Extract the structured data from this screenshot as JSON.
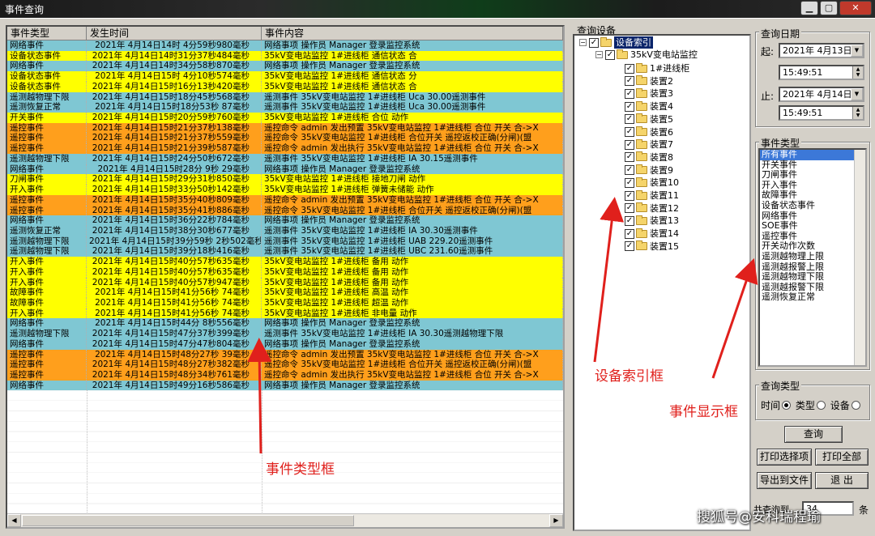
{
  "window": {
    "title": "事件查询",
    "btn_min": "▁",
    "btn_max": "▢",
    "btn_close": "✕"
  },
  "table": {
    "headers": [
      "事件类型",
      "发生时间",
      "事件内容"
    ],
    "rows": [
      {
        "type": "网络事件",
        "time": "2021年 4月14日14时 4分59秒980毫秒",
        "content": "网络事项 操作员 Manager 登录监控系统",
        "color": "blue"
      },
      {
        "type": "设备状态事件",
        "time": "2021年 4月14日14时31分37秒484毫秒",
        "content": "35kV变电站监控 1#进线柜 通信状态 合",
        "color": "yellow"
      },
      {
        "type": "网络事件",
        "time": "2021年 4月14日14时34分58秒870毫秒",
        "content": "网络事项 操作员 Manager 登录监控系统",
        "color": "blue"
      },
      {
        "type": "设备状态事件",
        "time": "2021年 4月14日15时 4分10秒574毫秒",
        "content": "35kV变电站监控 1#进线柜 通信状态 分",
        "color": "yellow"
      },
      {
        "type": "设备状态事件",
        "time": "2021年 4月14日15时16分13秒420毫秒",
        "content": "35kV变电站监控 1#进线柜 通信状态 合",
        "color": "yellow"
      },
      {
        "type": "遥测越物理下限",
        "time": "2021年 4月14日15时18分45秒568毫秒",
        "content": "遥测事件 35kV变电站监控 1#进线柜 Uca 30.00遥测事件",
        "color": "blue"
      },
      {
        "type": "遥测恢复正常",
        "time": "2021年 4月14日15时18分53秒 87毫秒",
        "content": "遥测事件 35kV变电站监控 1#进线柜 Uca 30.00遥测事件",
        "color": "blue"
      },
      {
        "type": "开关事件",
        "time": "2021年 4月14日15时20分59秒760毫秒",
        "content": "35kV变电站监控 1#进线柜 合位 动作",
        "color": "yellow"
      },
      {
        "type": "遥控事件",
        "time": "2021年 4月14日15时21分37秒138毫秒",
        "content": "遥控命令 admin 发出预置 35kV变电站监控 1#进线柜 合位 开关 合->X",
        "color": "orange"
      },
      {
        "type": "遥控事件",
        "time": "2021年 4月14日15时21分37秒559毫秒",
        "content": "遥控命令 35kV变电站监控 1#进线柜 合位开关 遥控返校正确(分闸)(盟",
        "color": "orange"
      },
      {
        "type": "遥控事件",
        "time": "2021年 4月14日15时21分39秒587毫秒",
        "content": "遥控命令 admin 发出执行 35kV变电站监控 1#进线柜 合位 开关 合->X",
        "color": "orange"
      },
      {
        "type": "遥测越物理下限",
        "time": "2021年 4月14日15时24分50秒672毫秒",
        "content": "遥测事件 35kV变电站监控 1#进线柜 IA 30.15遥测事件",
        "color": "blue"
      },
      {
        "type": "网络事件",
        "time": "2021年 4月14日15时28分 9秒 29毫秒",
        "content": "网络事项 操作员 Manager 登录监控系统",
        "color": "blue"
      },
      {
        "type": "刀闸事件",
        "time": "2021年 4月14日15时29分31秒850毫秒",
        "content": "35kV变电站监控 1#进线柜 接地刀闸 动作",
        "color": "yellow"
      },
      {
        "type": "开入事件",
        "time": "2021年 4月14日15时33分50秒142毫秒",
        "content": "35kV变电站监控 1#进线柜 弹簧未储能 动作",
        "color": "yellow"
      },
      {
        "type": "遥控事件",
        "time": "2021年 4月14日15时35分40秒809毫秒",
        "content": "遥控命令 admin 发出预置 35kV变电站监控 1#进线柜 合位 开关 合->X",
        "color": "orange"
      },
      {
        "type": "遥控事件",
        "time": "2021年 4月14日15时35分41秒886毫秒",
        "content": "遥控命令 35kV变电站监控 1#进线柜 合位开关 遥控返校正确(分闸)(盟",
        "color": "orange"
      },
      {
        "type": "网络事件",
        "time": "2021年 4月14日15时36分22秒784毫秒",
        "content": "网络事项 操作员 Manager 登录监控系统",
        "color": "blue"
      },
      {
        "type": "遥测恢复正常",
        "time": "2021年 4月14日15时38分30秒677毫秒",
        "content": "遥测事件 35kV变电站监控 1#进线柜 IA 30.30遥测事件",
        "color": "blue"
      },
      {
        "type": "遥测越物理下限",
        "time": "2021年 4月14日15时39分59秒 2秒502毫秒",
        "content": "遥测事件 35kV变电站监控 1#进线柜 UAB 229.20遥测事件",
        "color": "blue"
      },
      {
        "type": "遥测越物理下限",
        "time": "2021年 4月14日15时39分18秒416毫秒",
        "content": "遥测事件 35kV变电站监控 1#进线柜 UBC 231.60遥测事件",
        "color": "blue"
      },
      {
        "type": "开入事件",
        "time": "2021年 4月14日15时40分57秒635毫秒",
        "content": "35kV变电站监控 1#进线柜 备用 动作",
        "color": "yellow"
      },
      {
        "type": "开入事件",
        "time": "2021年 4月14日15时40分57秒635毫秒",
        "content": "35kV变电站监控 1#进线柜 备用 动作",
        "color": "yellow"
      },
      {
        "type": "开入事件",
        "time": "2021年 4月14日15时40分57秒947毫秒",
        "content": "35kV变电站监控 1#进线柜 备用 动作",
        "color": "yellow"
      },
      {
        "type": "故障事件",
        "time": "2021年 4月14日15时41分56秒 74毫秒",
        "content": "35kV变电站监控 1#进线柜 高温 动作",
        "color": "yellow"
      },
      {
        "type": "故障事件",
        "time": "2021年 4月14日15时41分56秒 74毫秒",
        "content": "35kV变电站监控 1#进线柜 超温 动作",
        "color": "yellow"
      },
      {
        "type": "开入事件",
        "time": "2021年 4月14日15时41分56秒 74毫秒",
        "content": "35kV变电站监控 1#进线柜 非电量 动作",
        "color": "yellow"
      },
      {
        "type": "网络事件",
        "time": "2021年 4月14日15时44分 8秒556毫秒",
        "content": "网络事项 操作员 Manager 登录监控系统",
        "color": "blue"
      },
      {
        "type": "遥测越物理下限",
        "time": "2021年 4月14日15时47分37秒399毫秒",
        "content": "遥测事件 35kV变电站监控 1#进线柜 IA 30.30遥测越物理下限",
        "color": "blue"
      },
      {
        "type": "网络事件",
        "time": "2021年 4月14日15时47分47秒804毫秒",
        "content": "网络事项 操作员 Manager 登录监控系统",
        "color": "blue"
      },
      {
        "type": "遥控事件",
        "time": "2021年 4月14日15时48分27秒 39毫秒",
        "content": "遥控命令 admin 发出预置 35kV变电站监控 1#进线柜 合位 开关 合->X",
        "color": "orange"
      },
      {
        "type": "遥控事件",
        "time": "2021年 4月14日15时48分27秒382毫秒",
        "content": "遥控命令 35kV变电站监控 1#进线柜 合位开关 遥控返校正确(分闸)(盟",
        "color": "orange"
      },
      {
        "type": "遥控事件",
        "time": "2021年 4月14日15时48分34秒761毫秒",
        "content": "遥控命令 admin 发出执行 35kV变电站监控 1#进线柜 合位 开关 合->X",
        "color": "orange"
      },
      {
        "type": "网络事件",
        "time": "2021年 4月14日15时49分16秒586毫秒",
        "content": "网络事项 操作员 Manager 登录监控系统",
        "color": "blue"
      }
    ]
  },
  "device": {
    "group_label": "查询设备",
    "root": "设备索引",
    "station": "35kV变电站监控",
    "items": [
      "1#进线柜",
      "装置2",
      "装置3",
      "装置4",
      "装置5",
      "装置6",
      "装置7",
      "装置8",
      "装置9",
      "装置10",
      "装置11",
      "装置12",
      "装置13",
      "装置14",
      "装置15"
    ]
  },
  "date_query": {
    "label": "查询日期",
    "start_label": "起:",
    "start_date": "2021年 4月13日",
    "start_time": "15:49:51",
    "end_label": "止:",
    "end_date": "2021年 4月14日",
    "end_time": "15:49:51"
  },
  "event_types": {
    "label": "事件类型",
    "items": [
      "所有事件",
      "开关事件",
      "刀闸事件",
      "开入事件",
      "故障事件",
      "设备状态事件",
      "网络事件",
      "SOE事件",
      "遥控事件",
      "开关动作次数",
      "遥测越物理上限",
      "遥测越报警上限",
      "遥测越物理下限",
      "遥测越报警下限",
      "遥测恢复正常"
    ],
    "selected": "所有事件"
  },
  "query_type": {
    "label": "查询类型",
    "time": "时间",
    "type": "类型",
    "device": "设备",
    "selected": "time"
  },
  "buttons": {
    "query": "查询",
    "print_selected": "打印选择项",
    "print_all": "打印全部",
    "export": "导出到文件",
    "exit": "退 出"
  },
  "footer": {
    "total_label": "共查询到",
    "total_value": "34",
    "unit": "条"
  },
  "annotations": {
    "event_type_box": "事件类型框",
    "device_index_box": "设备索引框",
    "event_display_box": "事件显示框"
  },
  "watermark": "搜狐号@安科瑞程瑜",
  "colors": {
    "blue": "#7fc7d3",
    "yellow": "#ffff00",
    "orange": "#ff9f1c",
    "annotation": "#e0201c"
  }
}
